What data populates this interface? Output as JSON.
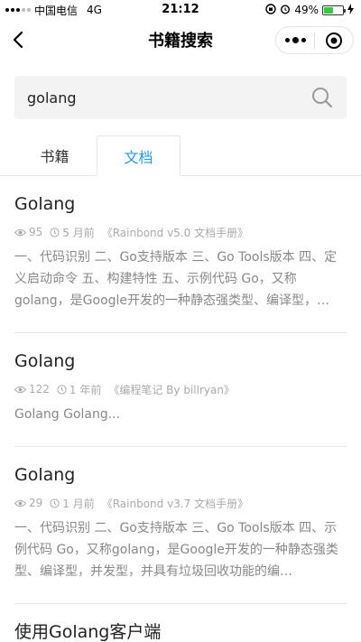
{
  "status_bar": {
    "carrier": "中国电信",
    "network": "4G",
    "time": "21:12",
    "battery": "49%",
    "battery_level": 0.49
  },
  "nav": {
    "title": "书籍搜索"
  },
  "search": {
    "value": "golang"
  },
  "tabs": [
    {
      "label": "书籍",
      "active": false
    },
    {
      "label": "文档",
      "active": true
    }
  ],
  "results": [
    {
      "title": "Golang",
      "views": "95",
      "time": "5 月前",
      "source": "《Rainbond v5.0 文档手册》",
      "desc": "一、代码识别 二、Go支持版本 三、Go Tools版本 四、定义启动命令 五、构建特性 五、示例代码 Go，又称golang，是Google开发的一种静态强类型、编译型，…"
    },
    {
      "title": "Golang",
      "views": "122",
      "time": "1 年前",
      "source": "《编程笔记 By billryan》",
      "desc": "Golang Golang..."
    },
    {
      "title": "Golang",
      "views": "29",
      "time": "1 月前",
      "source": "《Rainbond v3.7 文档手册》",
      "desc": "一、代码识别 二、Go支持版本 三、Go Tools版本 四、示例代码 Go，又称golang，是Google开发的一种静态强类型、编译型，并发型，并具有垃圾回收功能的编…"
    },
    {
      "title": "使用Golang客户端"
    }
  ],
  "icons": {
    "views": "eye-icon",
    "time": "clock-icon",
    "search": "search-icon",
    "back": "back-arrow-icon"
  },
  "colors": {
    "accent": "#1d9bf0",
    "battery": "#2ecc40"
  }
}
